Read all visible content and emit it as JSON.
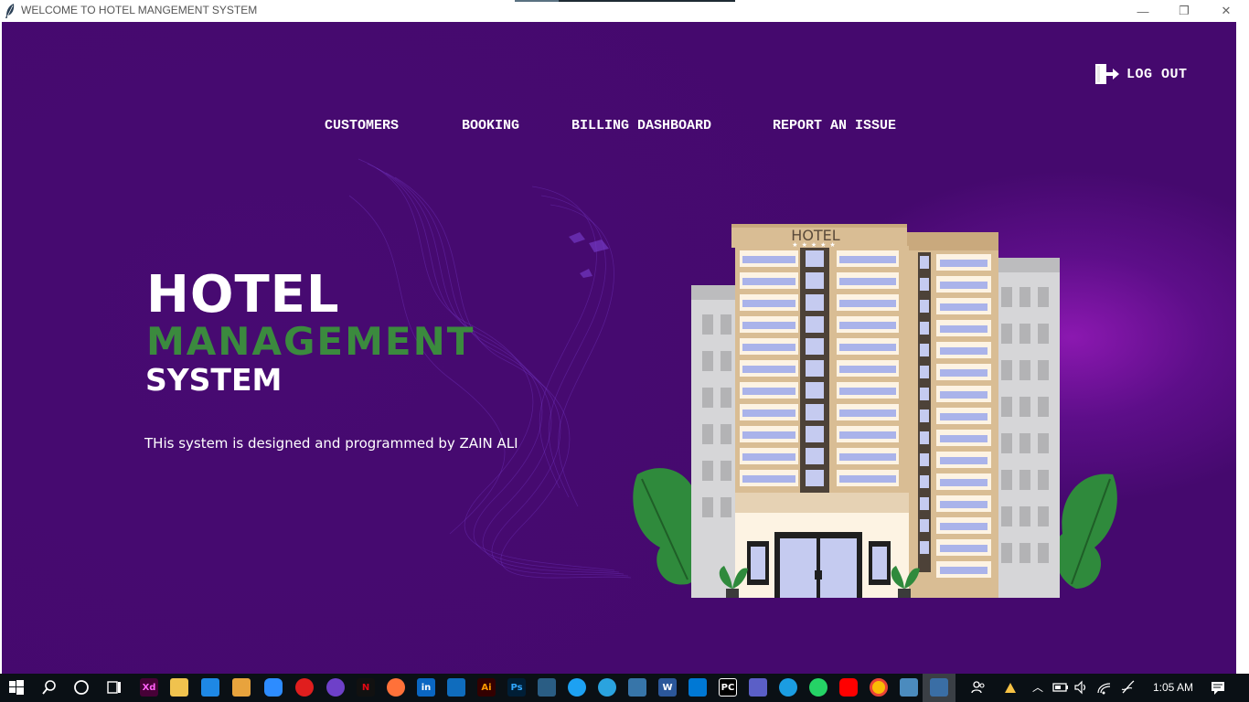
{
  "window": {
    "title": "WELCOME TO HOTEL MANGEMENT SYSTEM",
    "controls": {
      "minimize": "—",
      "restore": "❐",
      "close": "✕"
    }
  },
  "header": {
    "logout_label": "LOG OUT"
  },
  "nav": {
    "items": [
      {
        "label": "CUSTOMERS"
      },
      {
        "label": "BOOKING"
      },
      {
        "label": "BILLING DASHBOARD"
      },
      {
        "label": "REPORT AN ISSUE"
      }
    ]
  },
  "hero": {
    "line1": "HOTEL",
    "line2": "MANAGEMENT",
    "line3": "SYSTEM",
    "credit": "THis system is designed  and programmed by ZAIN ALI"
  },
  "illustration": {
    "sign": "HOTEL"
  },
  "colors": {
    "background": "#45096e",
    "accent_green": "#3b8a3e",
    "glow": "#8b18b0"
  },
  "taskbar": {
    "apps": [
      "start-icon",
      "search-icon",
      "cortana-icon",
      "task-view-icon",
      "adobe-xd-icon",
      "file-explorer-icon",
      "mail-icon",
      "store-icon",
      "zoom-icon",
      "opera-icon",
      "github-icon",
      "netflix-icon",
      "firefox-icon",
      "linkedin-icon",
      "outlook-icon",
      "illustrator-icon",
      "photoshop-icon",
      "network-app-icon",
      "twitter-icon",
      "telegram-icon",
      "python-idle-icon",
      "word-icon",
      "vscode-icon",
      "pycharm-icon",
      "teams-icon",
      "edge-icon",
      "whatsapp-icon",
      "youtube-icon",
      "chrome-icon",
      "python-icon",
      "tkinter-app-icon"
    ],
    "labels": {
      "xd": "Xd",
      "ai": "Ai",
      "ps": "Ps",
      "pc": "PC",
      "in": "in"
    },
    "time": "1:05 AM"
  }
}
